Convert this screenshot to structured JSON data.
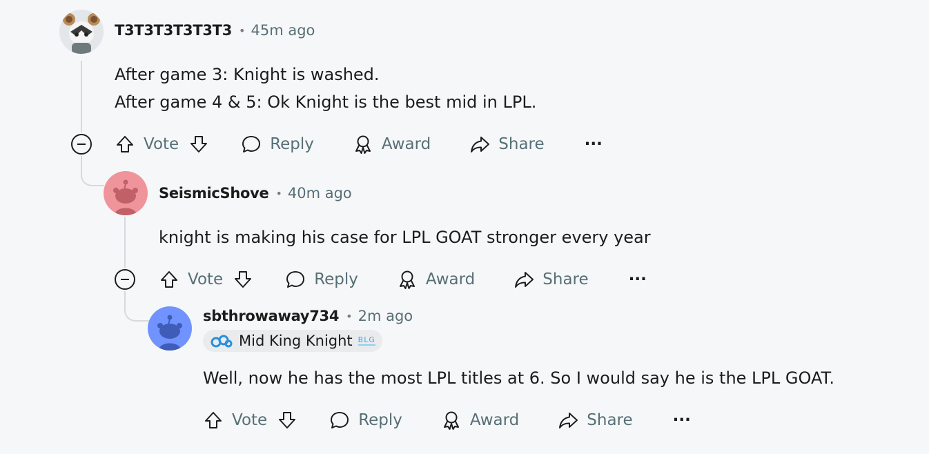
{
  "comments": [
    {
      "username": "T3T3T3T3T3T3",
      "separator": "•",
      "time": "45m ago",
      "body_lines": [
        "After game 3: Knight is washed.",
        "After game 4 & 5: Ok Knight is the best mid in LPL."
      ],
      "avatar_icon": "mouse-ear-character-icon"
    },
    {
      "username": "SeismicShove",
      "separator": "•",
      "time": "40m ago",
      "body_lines": [
        "knight is making his case for LPL GOAT stronger every year"
      ],
      "avatar_icon": "snoo-avatar-icon",
      "avatar_color": "#f0949b"
    },
    {
      "username": "sbthrowaway734",
      "separator": "•",
      "time": "2m ago",
      "flair": {
        "label": "Mid King Knight",
        "team_mark": "BLG",
        "icon": "cloud9-logo-icon"
      },
      "body_lines": [
        "Well, now he has the most LPL titles at 6. So I would say he is the LPL GOAT."
      ],
      "avatar_icon": "snoo-avatar-icon",
      "avatar_color": "#7193ff"
    }
  ],
  "actions": {
    "vote": "Vote",
    "reply": "Reply",
    "award": "Award",
    "share": "Share",
    "more": "···"
  },
  "colors": {
    "meta_gray": "#576f76",
    "thread_line": "#d7dadc",
    "background": "#f6f7f8"
  }
}
